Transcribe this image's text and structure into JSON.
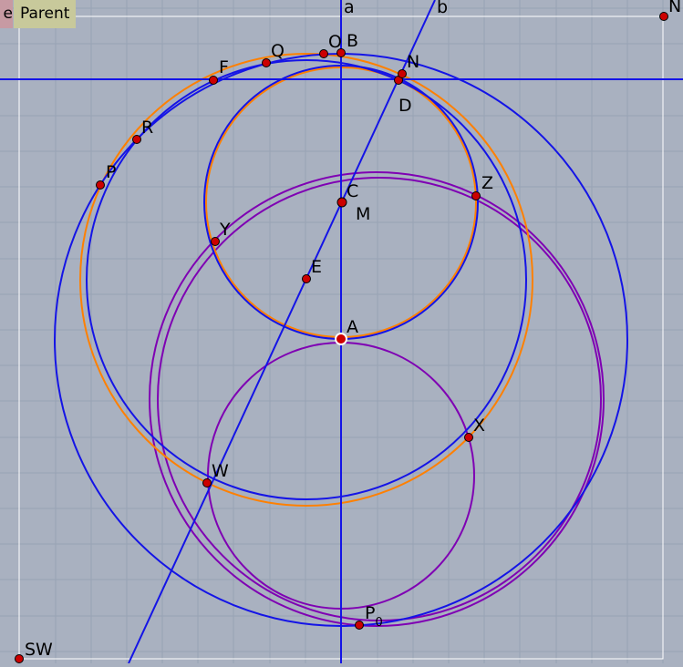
{
  "toolbar": {
    "left_tab_label": "e",
    "parent_label": "Parent"
  },
  "colors": {
    "background": "#a9b1c0",
    "grid": "#98a2b4",
    "blue": "#1414e6",
    "orange": "#ff8000",
    "purple": "#7f00b3",
    "point_fill": "#cc0000",
    "frame": "#ffffff"
  },
  "lines": [
    {
      "id": "a",
      "label": "a"
    },
    {
      "id": "b",
      "label": "b"
    }
  ],
  "points": [
    {
      "id": "A",
      "label": "A"
    },
    {
      "id": "B",
      "label": "B"
    },
    {
      "id": "C",
      "label": "C"
    },
    {
      "id": "D",
      "label": "D"
    },
    {
      "id": "E",
      "label": "E"
    },
    {
      "id": "F",
      "label": "F"
    },
    {
      "id": "M",
      "label": "M"
    },
    {
      "id": "N",
      "label": "N"
    },
    {
      "id": "O",
      "label": "O"
    },
    {
      "id": "P",
      "label": "P"
    },
    {
      "id": "Q",
      "label": "Q"
    },
    {
      "id": "R",
      "label": "R"
    },
    {
      "id": "W",
      "label": "W"
    },
    {
      "id": "X",
      "label": "X"
    },
    {
      "id": "Y",
      "label": "Y"
    },
    {
      "id": "Z",
      "label": "Z"
    },
    {
      "id": "P0",
      "label": "P",
      "subscript": "0"
    },
    {
      "id": "NE",
      "label": "NE"
    },
    {
      "id": "SW",
      "label": "SW"
    }
  ]
}
